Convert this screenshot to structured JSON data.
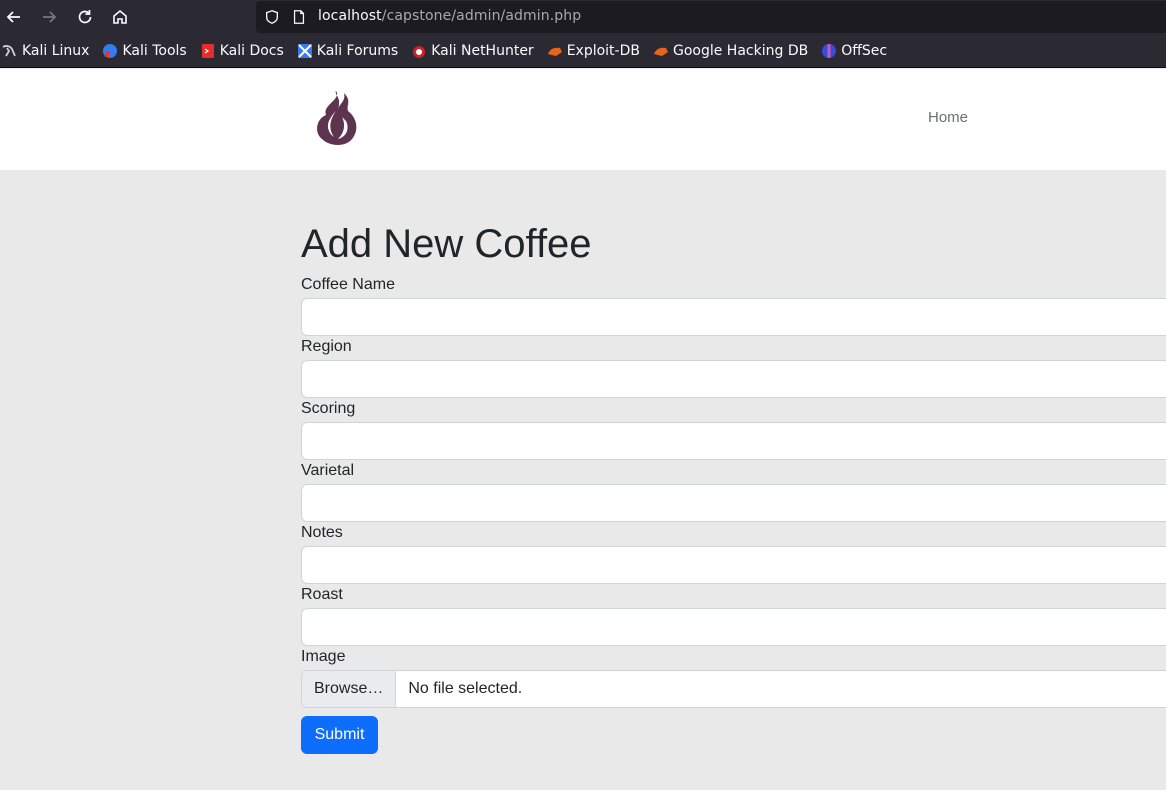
{
  "browser": {
    "url_host": "localhost",
    "url_path": "/capstone/admin/admin.php",
    "bookmarks": [
      {
        "label": "Kali Linux",
        "icon": "kali-dragon-icon"
      },
      {
        "label": "Kali Tools",
        "icon": "kali-tools-icon"
      },
      {
        "label": "Kali Docs",
        "icon": "kali-docs-icon"
      },
      {
        "label": "Kali Forums",
        "icon": "kali-forums-icon"
      },
      {
        "label": "Kali NetHunter",
        "icon": "nethunter-icon"
      },
      {
        "label": "Exploit-DB",
        "icon": "exploit-db-icon"
      },
      {
        "label": "Google Hacking DB",
        "icon": "ghdb-icon"
      },
      {
        "label": "OffSec",
        "icon": "offsec-icon"
      }
    ]
  },
  "header": {
    "nav_home": "Home",
    "brand_color": "#5e3350"
  },
  "form": {
    "title": "Add New Coffee",
    "fields": [
      {
        "label": "Coffee Name",
        "value": ""
      },
      {
        "label": "Region",
        "value": ""
      },
      {
        "label": "Scoring",
        "value": ""
      },
      {
        "label": "Varietal",
        "value": ""
      },
      {
        "label": "Notes",
        "value": ""
      },
      {
        "label": "Roast",
        "value": ""
      }
    ],
    "image_label": "Image",
    "browse_label": "Browse…",
    "file_status": "No file selected.",
    "submit_label": "Submit",
    "accent_color": "#0d6efd"
  }
}
